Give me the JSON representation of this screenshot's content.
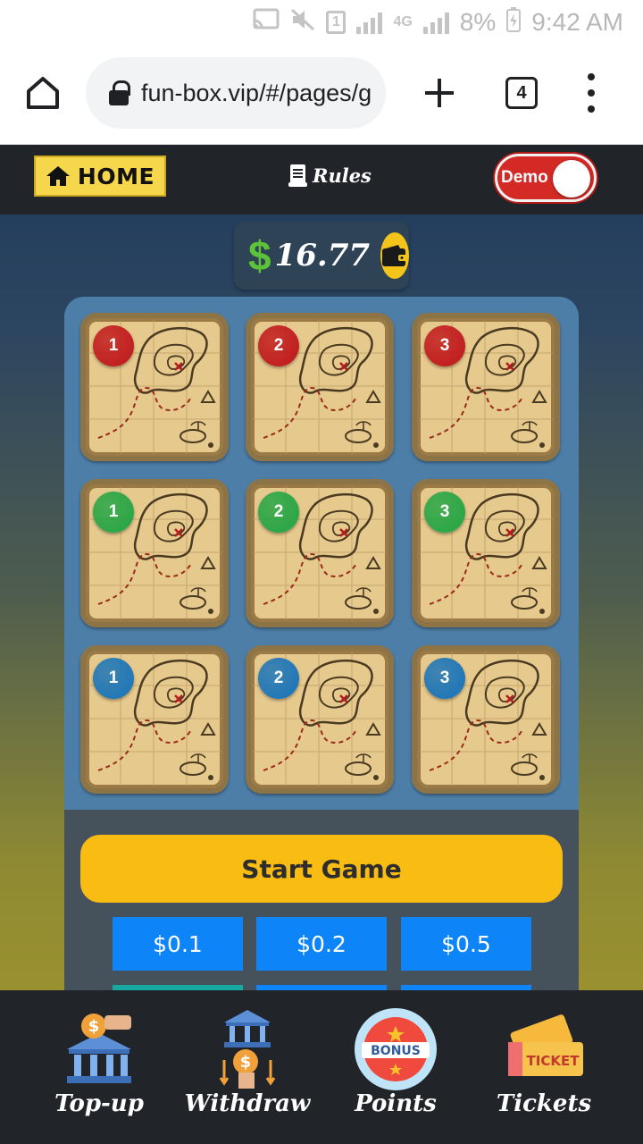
{
  "status_bar": {
    "battery": "8%",
    "time": "9:42 AM",
    "sim_label": "1",
    "network_label": "4G"
  },
  "browser": {
    "url": "fun-box.vip/#/pages/g",
    "tab_count": "4"
  },
  "header": {
    "home_label": "HOME",
    "rules_label": "Rules",
    "demo_label": "Demo",
    "demo_on": true
  },
  "balance": {
    "currency": "$",
    "amount": "16.77"
  },
  "tiles": [
    {
      "number": "1",
      "color": "#c0161a"
    },
    {
      "number": "2",
      "color": "#c0161a"
    },
    {
      "number": "3",
      "color": "#c0161a"
    },
    {
      "number": "1",
      "color": "#21a543"
    },
    {
      "number": "2",
      "color": "#21a543"
    },
    {
      "number": "3",
      "color": "#21a543"
    },
    {
      "number": "1",
      "color": "#1673ba"
    },
    {
      "number": "2",
      "color": "#1673ba"
    },
    {
      "number": "3",
      "color": "#1673ba"
    }
  ],
  "actions": {
    "start_label": "Start Game",
    "bets": [
      "$0.1",
      "$0.2",
      "$0.5"
    ]
  },
  "bottom_nav": [
    {
      "label": "Top-up",
      "icon": "bank-deposit-icon"
    },
    {
      "label": "Withdraw",
      "icon": "bank-withdraw-icon"
    },
    {
      "label": "Points",
      "icon": "bonus-icon",
      "badge_text": "BONUS"
    },
    {
      "label": "Tickets",
      "icon": "ticket-icon",
      "badge_text": "TICKET"
    }
  ]
}
